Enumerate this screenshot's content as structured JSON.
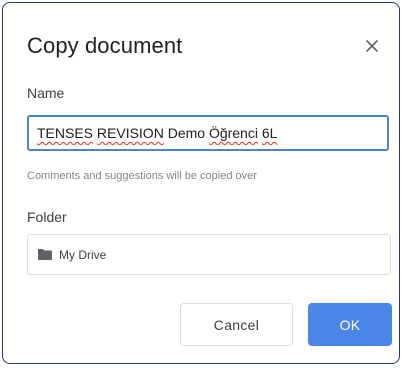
{
  "dialog": {
    "title": "Copy document",
    "close_icon": "close-icon"
  },
  "name_field": {
    "label": "Name",
    "value_parts": [
      "TENSES",
      " ",
      "REVISION",
      " Demo ",
      "Öğrenci",
      " ",
      "6L"
    ],
    "hint": "Comments and suggestions will be copied over"
  },
  "folder_field": {
    "label": "Folder",
    "icon": "folder-icon",
    "value": "My Drive"
  },
  "buttons": {
    "cancel_label": "Cancel",
    "ok_label": "OK"
  },
  "colors": {
    "accent": "#4a86e8",
    "input_focus_border": "#4a82d6",
    "spellcheck_underline": "#d93025",
    "dialog_border": "#2a3a5e"
  }
}
